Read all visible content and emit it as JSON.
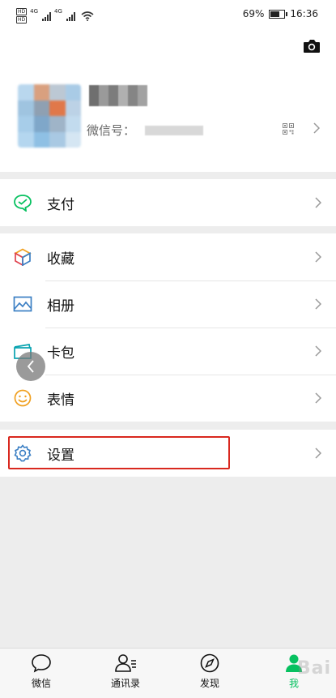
{
  "status_bar": {
    "network_left": "4G",
    "network_right": "4G",
    "battery_percent_text": "69%",
    "battery_level": 0.69,
    "time": "16:36"
  },
  "profile": {
    "wechat_id_label": "微信号：",
    "avatar_colors": [
      "#b9d7ee",
      "#d9a07f",
      "#bcc8d4",
      "#a9cbe6",
      "#9fc4e0",
      "#8fa0b2",
      "#e0784a",
      "#bcd2e6",
      "#a7cde9",
      "#7fa7c9",
      "#9fb4c8",
      "#c2dbee",
      "#b4d6ef",
      "#8fc0e4",
      "#a9c9e3",
      "#d5e6f3"
    ],
    "nick_colors": [
      "#6f6f6f",
      "#9a9a9a",
      "#7c7c7c",
      "#b0b0b0",
      "#858585",
      "#a2a2a2"
    ]
  },
  "menu": {
    "pay": "支付",
    "favorites": "收藏",
    "album": "相册",
    "cards": "卡包",
    "stickers": "表情",
    "settings": "设置"
  },
  "tabbar": {
    "chats": "微信",
    "contacts": "通讯录",
    "discover": "发现",
    "me": "我"
  },
  "watermark": "Bai",
  "colors": {
    "accent_green": "#07c160",
    "highlight_red": "#d9281f",
    "icon_blue": "#3b7fc4"
  }
}
